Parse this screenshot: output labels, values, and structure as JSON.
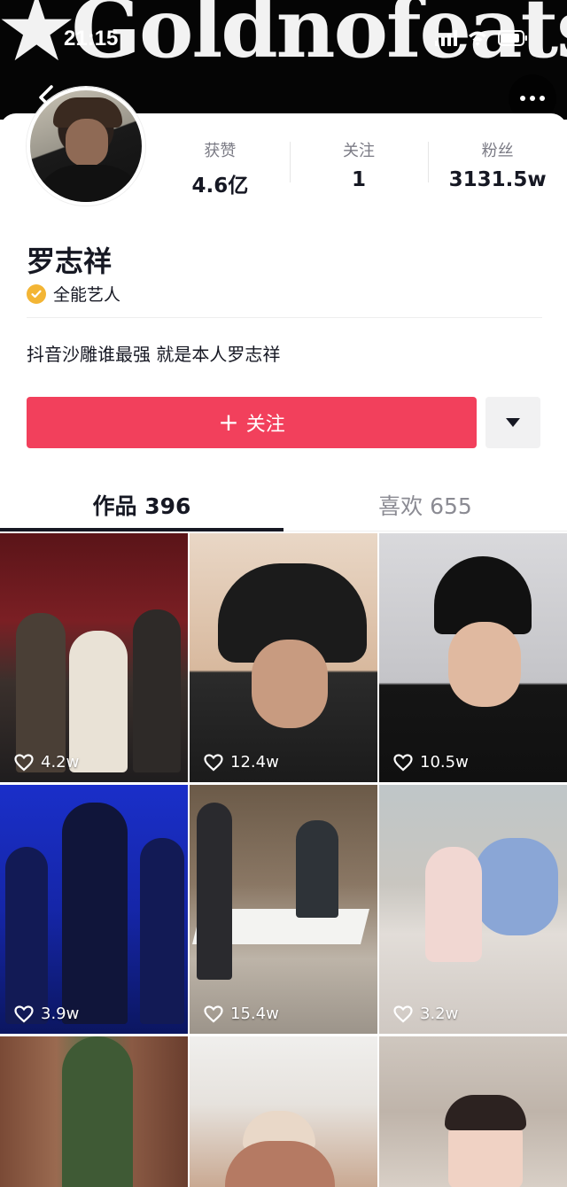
{
  "status_bar": {
    "time": "21:15"
  },
  "banner": {
    "text": "★Goldnofeats★"
  },
  "profile": {
    "avatar_alt": "avatar",
    "name": "罗志祥",
    "badge": "全能艺人",
    "bio": "抖音沙雕谁最强 就是本人罗志祥",
    "stats": [
      {
        "label": "获赞",
        "value": "4.6亿"
      },
      {
        "label": "关注",
        "value": "1"
      },
      {
        "label": "粉丝",
        "value": "3131.5w"
      }
    ]
  },
  "actions": {
    "follow_label": "关注",
    "follow_plus": "+"
  },
  "tabs": [
    {
      "label": "作品 396",
      "active": true
    },
    {
      "label": "喜欢 655",
      "active": false
    }
  ],
  "videos": [
    {
      "likes": "4.2w"
    },
    {
      "likes": "12.4w"
    },
    {
      "likes": "10.5w"
    },
    {
      "likes": "3.9w"
    },
    {
      "likes": "15.4w"
    },
    {
      "likes": "3.2w"
    },
    {
      "likes": ""
    },
    {
      "likes": ""
    },
    {
      "likes": ""
    }
  ],
  "colors": {
    "accent": "#f2405c",
    "badge": "#f3b535",
    "text": "#161823",
    "muted": "#8b8b93"
  },
  "icons": [
    "back-icon",
    "more-icon",
    "verified-icon",
    "caret-down-icon",
    "heart-icon"
  ]
}
